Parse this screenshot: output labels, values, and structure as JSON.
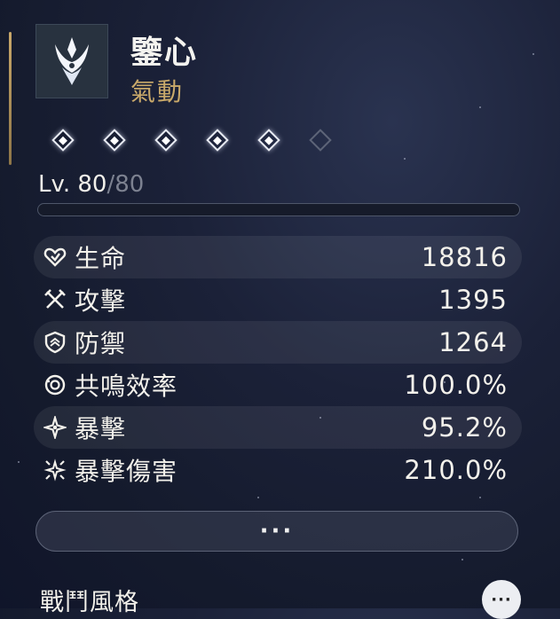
{
  "character": {
    "name": "鑒心",
    "element": "氣動",
    "emblem_icon": "aero-emblem-icon"
  },
  "resonance_chain": {
    "total": 6,
    "unlocked": 5
  },
  "level": {
    "prefix": "Lv. ",
    "current": "80",
    "separator": "/",
    "max": "80",
    "exp_progress": 0
  },
  "stats": [
    {
      "icon": "heart-icon",
      "label": "生命",
      "value": "18816"
    },
    {
      "icon": "crossed-swords-icon",
      "label": "攻擊",
      "value": "1395"
    },
    {
      "icon": "shield-icon",
      "label": "防禦",
      "value": "1264"
    },
    {
      "icon": "energy-regen-icon",
      "label": "共鳴效率",
      "value": "100.0%"
    },
    {
      "icon": "crit-star-icon",
      "label": "暴擊",
      "value": "95.2%"
    },
    {
      "icon": "crit-burst-icon",
      "label": "暴擊傷害",
      "value": "210.0%"
    }
  ],
  "more_button": {
    "label": "···"
  },
  "section": {
    "title": "戰鬥風格",
    "more_icon": "ellipsis-icon",
    "more_label": "···"
  },
  "colors": {
    "gold": "#c9a96a",
    "text": "#f3f1eb"
  }
}
